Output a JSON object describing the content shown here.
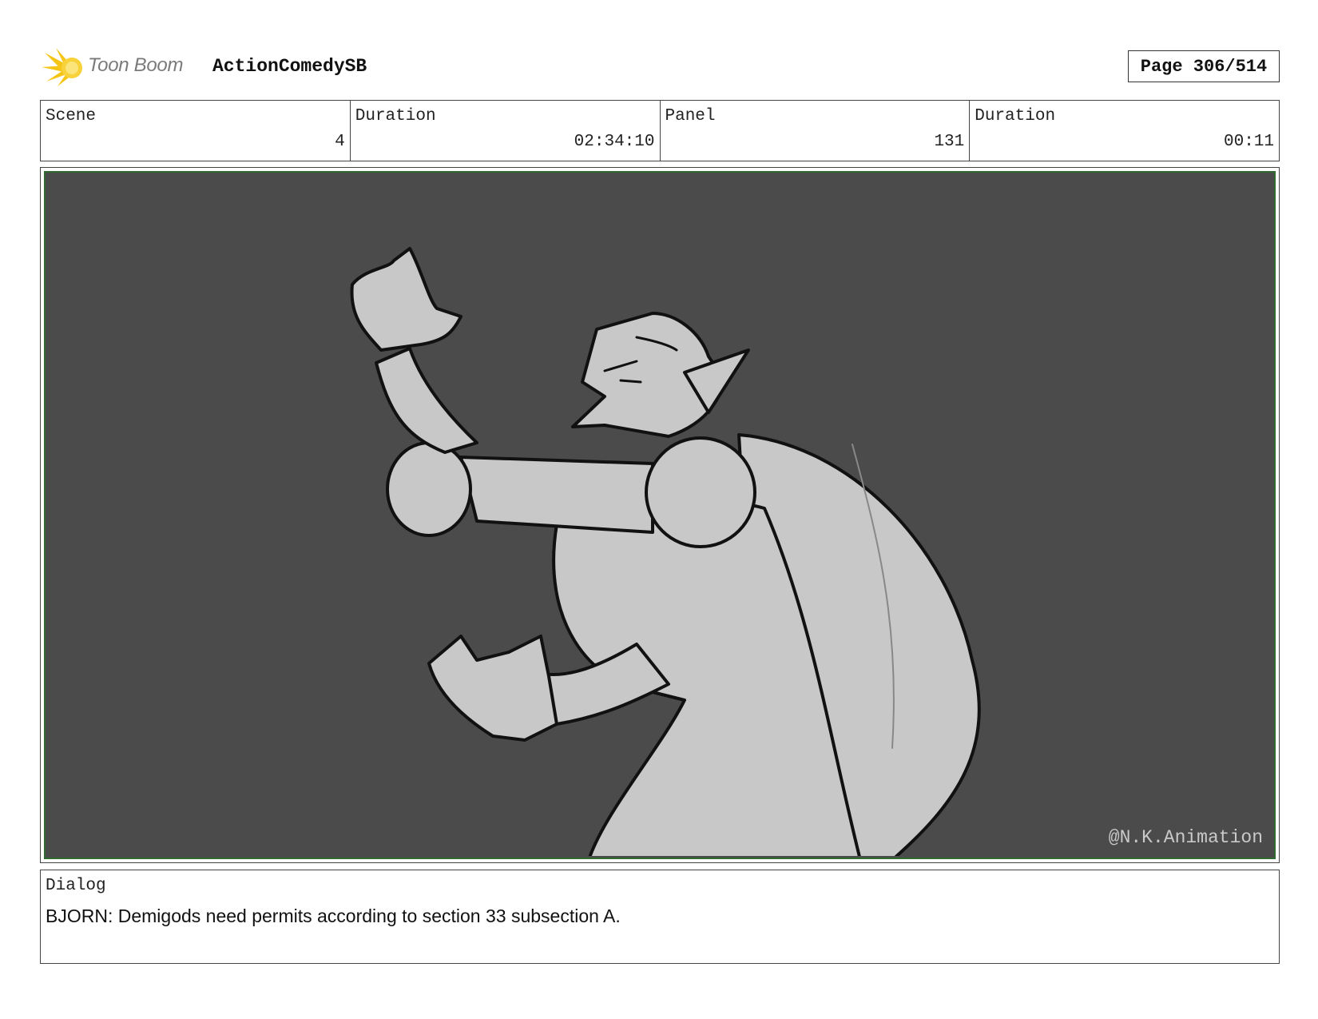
{
  "header": {
    "logo_text": "Toon Boom",
    "project": "ActionComedySB",
    "page": "Page 306/514"
  },
  "info": [
    {
      "label": "Scene",
      "value": "4"
    },
    {
      "label": "Duration",
      "value": "02:34:10"
    },
    {
      "label": "Panel",
      "value": "131"
    },
    {
      "label": "Duration",
      "value": "00:11"
    }
  ],
  "panel": {
    "watermark": "@N.K.Animation",
    "background_color": "#4b4b4b",
    "border_color": "#2f6b2f"
  },
  "dialog": {
    "label": "Dialog",
    "text": "BJORN: Demigods need permits according to section 33 subsection A."
  },
  "colors": {
    "logo_accent": "#f5c518",
    "logo_text": "#7a7a7a"
  },
  "icons": {
    "logo": "toon-boom-burst-icon"
  }
}
